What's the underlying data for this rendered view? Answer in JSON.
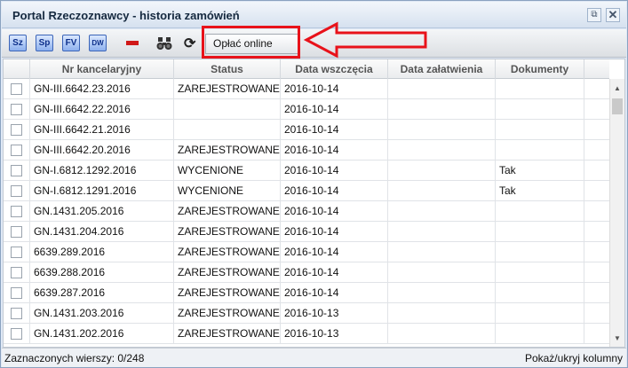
{
  "window": {
    "title": "Portal Rzeczoznawcy - historia zamówień",
    "popout_symbol": "⧉",
    "close_symbol": "✕"
  },
  "toolbar": {
    "sz": "Sz",
    "sp": "Sp",
    "fv": "FV",
    "dw": "DW",
    "refresh_symbol": "⟳",
    "pay_online": "Opłać online"
  },
  "table": {
    "columns": [
      "Nr kancelaryjny",
      "Status",
      "Data wszczęcia",
      "Data załatwienia",
      "Dokumenty"
    ],
    "rows": [
      {
        "nr": "GN-III.6642.23.2016",
        "status": "ZAREJESTROWANE",
        "start": "2016-10-14",
        "end": "",
        "docs": ""
      },
      {
        "nr": "GN-III.6642.22.2016",
        "status": "",
        "start": "2016-10-14",
        "end": "",
        "docs": ""
      },
      {
        "nr": "GN-III.6642.21.2016",
        "status": "",
        "start": "2016-10-14",
        "end": "",
        "docs": ""
      },
      {
        "nr": "GN-III.6642.20.2016",
        "status": "ZAREJESTROWANE",
        "start": "2016-10-14",
        "end": "",
        "docs": ""
      },
      {
        "nr": "GN-I.6812.1292.2016",
        "status": "WYCENIONE",
        "start": "2016-10-14",
        "end": "",
        "docs": "Tak"
      },
      {
        "nr": "GN-I.6812.1291.2016",
        "status": "WYCENIONE",
        "start": "2016-10-14",
        "end": "",
        "docs": "Tak"
      },
      {
        "nr": "GN.1431.205.2016",
        "status": "ZAREJESTROWANE",
        "start": "2016-10-14",
        "end": "",
        "docs": ""
      },
      {
        "nr": "GN.1431.204.2016",
        "status": "ZAREJESTROWANE",
        "start": "2016-10-14",
        "end": "",
        "docs": ""
      },
      {
        "nr": "6639.289.2016",
        "status": "ZAREJESTROWANE",
        "start": "2016-10-14",
        "end": "",
        "docs": ""
      },
      {
        "nr": "6639.288.2016",
        "status": "ZAREJESTROWANE",
        "start": "2016-10-14",
        "end": "",
        "docs": ""
      },
      {
        "nr": "6639.287.2016",
        "status": "ZAREJESTROWANE",
        "start": "2016-10-14",
        "end": "",
        "docs": ""
      },
      {
        "nr": "GN.1431.203.2016",
        "status": "ZAREJESTROWANE",
        "start": "2016-10-13",
        "end": "",
        "docs": ""
      },
      {
        "nr": "GN.1431.202.2016",
        "status": "ZAREJESTROWANE",
        "start": "2016-10-13",
        "end": "",
        "docs": ""
      }
    ]
  },
  "statusbar": {
    "selected": "Zaznaczonych wierszy: 0/248",
    "toggle_columns": "Pokaż/ukryj kolumny"
  },
  "icons": {
    "minus": "minus-icon",
    "binoculars": "binoculars-icon",
    "refresh": "refresh-icon"
  },
  "colors": {
    "highlight": "#e8121a",
    "tool_blue": "#3b64b8"
  }
}
